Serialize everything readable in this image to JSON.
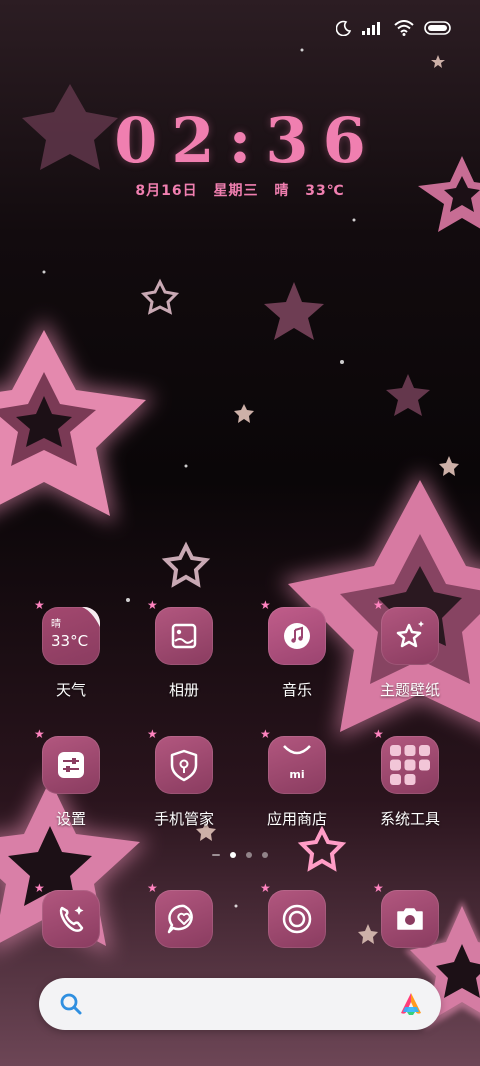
{
  "clock": {
    "time": "02:36"
  },
  "date": {
    "day": "8月16日",
    "weekday": "星期三",
    "weather": "晴",
    "temp": "33℃"
  },
  "status_icons": [
    "moon-icon",
    "signal-icon",
    "wifi-icon",
    "battery-icon"
  ],
  "apps": [
    {
      "id": "weather",
      "label": "天气",
      "icon": "weather-icon",
      "weather_cond": "晴",
      "weather_temp": "33°C"
    },
    {
      "id": "gallery",
      "label": "相册",
      "icon": "gallery-icon"
    },
    {
      "id": "music",
      "label": "音乐",
      "icon": "music-icon"
    },
    {
      "id": "themes",
      "label": "主题壁纸",
      "icon": "theme-star-icon"
    },
    {
      "id": "settings",
      "label": "设置",
      "icon": "settings-icon"
    },
    {
      "id": "security",
      "label": "手机管家",
      "icon": "shield-icon"
    },
    {
      "id": "appstore",
      "label": "应用商店",
      "icon": "shopping-bag-icon"
    },
    {
      "id": "tools",
      "label": "系统工具",
      "icon": "folder-grid-icon"
    }
  ],
  "dock": [
    {
      "id": "phone",
      "icon": "phone-icon"
    },
    {
      "id": "messages",
      "icon": "message-heart-icon"
    },
    {
      "id": "browser",
      "icon": "browser-icon"
    },
    {
      "id": "camera",
      "icon": "camera-icon"
    }
  ],
  "pager": {
    "pages": 3,
    "current": 1
  },
  "search": {
    "icon": "search-icon",
    "assistant_icon": "app-vault-icon"
  },
  "colors": {
    "accent": "#f07fb0",
    "tile": "#9e4870",
    "pin": "#ff84c0"
  }
}
